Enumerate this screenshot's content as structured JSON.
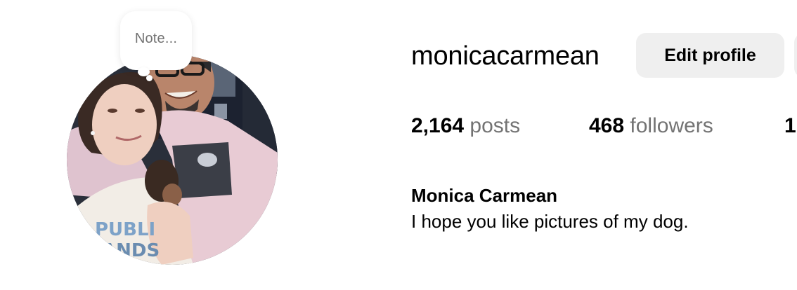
{
  "profile": {
    "note_placeholder": "Note...",
    "avatar_alt": "monicacarmean's profile picture",
    "username": "monicacarmean",
    "edit_profile_label": "Edit profile",
    "full_name": "Monica Carmean",
    "bio": "I hope you like pictures of my dog."
  },
  "stats": {
    "posts": {
      "count": "2,164",
      "label": "posts"
    },
    "followers": {
      "count": "468",
      "label": "followers"
    },
    "following": {
      "count": "1",
      "label": ""
    }
  },
  "colors": {
    "button_bg": "#efefef",
    "secondary_text": "#737373",
    "primary_text": "#000000",
    "background": "#ffffff"
  }
}
